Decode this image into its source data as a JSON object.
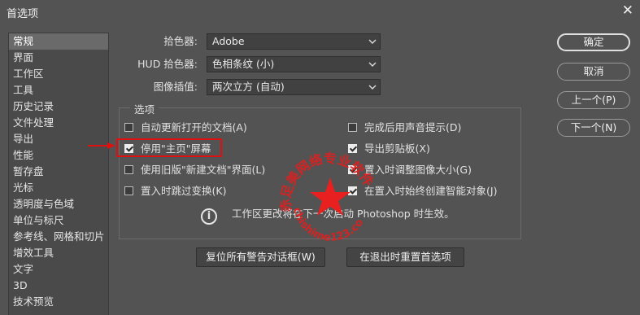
{
  "window": {
    "title": "首选项",
    "close_glyph": "✕"
  },
  "sidebar": {
    "items": [
      {
        "label": "常规",
        "active": true
      },
      {
        "label": "界面"
      },
      {
        "label": "工作区"
      },
      {
        "label": "工具"
      },
      {
        "label": "历史记录"
      },
      {
        "label": "文件处理"
      },
      {
        "label": "导出"
      },
      {
        "label": "性能"
      },
      {
        "label": "暂存盘"
      },
      {
        "label": "光标"
      },
      {
        "label": "透明度与色域"
      },
      {
        "label": "单位与标尺"
      },
      {
        "label": "参考线、网格和切片"
      },
      {
        "label": "增效工具"
      },
      {
        "label": "文字"
      },
      {
        "label": "3D"
      },
      {
        "label": "技术预览"
      }
    ]
  },
  "settings": {
    "color_picker": {
      "label": "拾色器:",
      "value": "Adobe"
    },
    "hud_color_picker": {
      "label": "HUD 拾色器:",
      "value": "色相条纹 (小)"
    },
    "image_interpolation": {
      "label": "图像插值:",
      "value": "两次立方 (自动)"
    }
  },
  "options": {
    "title": "选项",
    "left": [
      {
        "label": "自动更新打开的文档(A)",
        "checked": false
      },
      {
        "label": "停用\"主页\"屏幕",
        "checked": true
      },
      {
        "label": "使用旧版\"新建文档\"界面(L)",
        "checked": false
      },
      {
        "label": "置入时跳过变换(K)",
        "checked": false
      }
    ],
    "right": [
      {
        "label": "完成后用声音提示(D)",
        "checked": false
      },
      {
        "label": "导出剪贴板(X)",
        "checked": true
      },
      {
        "label": "置入时调整图像大小(G)",
        "checked": true
      },
      {
        "label": "在置入时始终创建智能对象(J)",
        "checked": true
      }
    ],
    "info": "工作区更改将在下一次启动 Photoshop 时生效。"
  },
  "buttons": {
    "ok": "确定",
    "cancel": "取消",
    "prev": "上一个(P)",
    "next": "下一个(N)",
    "reset_warnings": "复位所有警告对话框(W)",
    "reset_prefs": "在退出时重置首选项"
  },
  "watermark": {
    "line1": "赤足美网络专业软件",
    "line2": "chishime123.com"
  },
  "colors": {
    "background": "#535353",
    "highlight": "#e01010",
    "stamp": "#e02020"
  }
}
